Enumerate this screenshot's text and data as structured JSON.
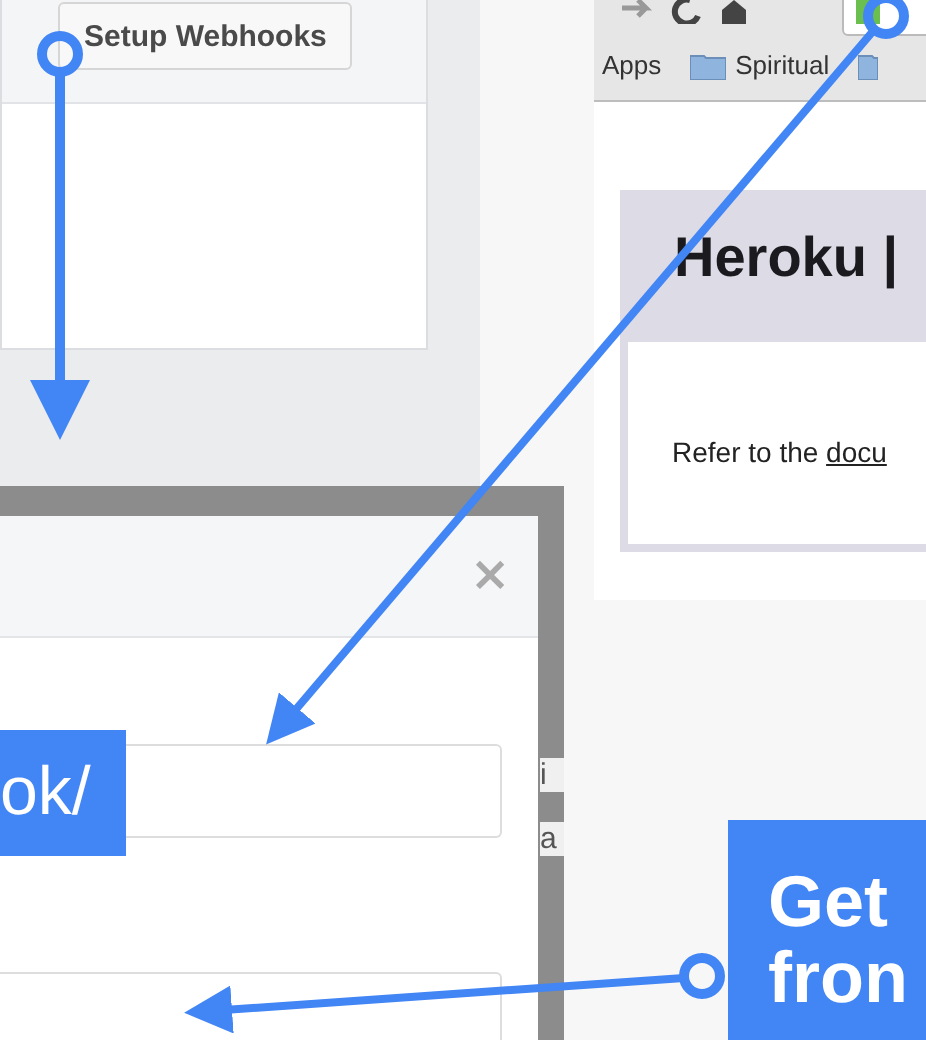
{
  "webhooks_panel": {
    "button": "Setup Webhooks"
  },
  "browser": {
    "bookmarks": [
      {
        "label": "Apps",
        "kind": "text"
      },
      {
        "label": "Spiritual",
        "kind": "folder"
      }
    ],
    "page_title": "Heroku |",
    "body_text": "Refer to the ",
    "body_link": "docu"
  },
  "dialog": {
    "close": "×",
    "behind_text": [
      "i",
      "a"
    ]
  },
  "callouts": [
    {
      "lines": [
        "ok/"
      ],
      "bold": false
    },
    {
      "lines": [
        "Get",
        "fron"
      ],
      "bold": true
    }
  ]
}
